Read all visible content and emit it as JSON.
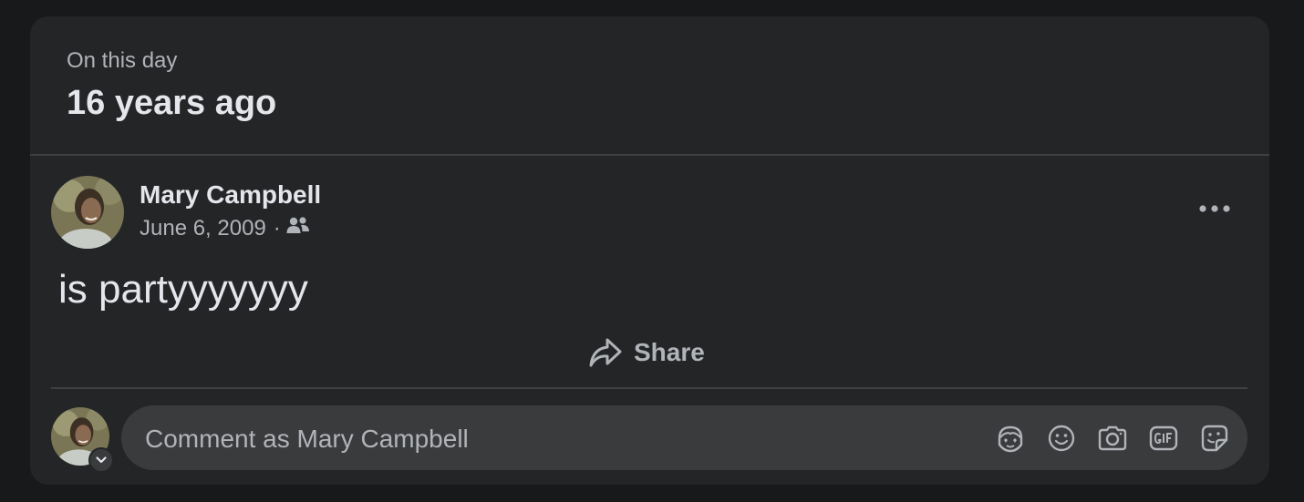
{
  "memory": {
    "eyebrow": "On this day",
    "headline": "16 years ago"
  },
  "post": {
    "author": "Mary Campbell",
    "date": "June 6, 2009",
    "separator": "·",
    "audience_icon": "friends-icon",
    "text": "is partyyyyyyy",
    "more_icon": "more-options-icon"
  },
  "actions": {
    "share_label": "Share",
    "share_icon": "share-icon"
  },
  "comment": {
    "placeholder": "Comment as Mary Campbell",
    "icons": [
      "avatar-sticker-icon",
      "emoji-icon",
      "camera-icon",
      "gif-icon",
      "sticker-icon"
    ]
  },
  "colors": {
    "background": "#18191a",
    "card": "#242526",
    "input": "#3a3b3c",
    "primary_text": "#e4e6eb",
    "secondary_text": "#b0b3b8",
    "divider": "#3e4042"
  }
}
